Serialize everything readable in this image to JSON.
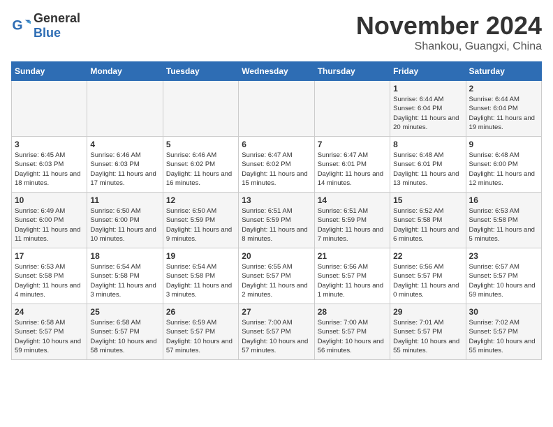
{
  "logo": {
    "text_general": "General",
    "text_blue": "Blue"
  },
  "title": {
    "month_year": "November 2024",
    "location": "Shankou, Guangxi, China"
  },
  "weekdays": [
    "Sunday",
    "Monday",
    "Tuesday",
    "Wednesday",
    "Thursday",
    "Friday",
    "Saturday"
  ],
  "weeks": [
    [
      {
        "day": "",
        "info": ""
      },
      {
        "day": "",
        "info": ""
      },
      {
        "day": "",
        "info": ""
      },
      {
        "day": "",
        "info": ""
      },
      {
        "day": "",
        "info": ""
      },
      {
        "day": "1",
        "info": "Sunrise: 6:44 AM\nSunset: 6:04 PM\nDaylight: 11 hours and 20 minutes."
      },
      {
        "day": "2",
        "info": "Sunrise: 6:44 AM\nSunset: 6:04 PM\nDaylight: 11 hours and 19 minutes."
      }
    ],
    [
      {
        "day": "3",
        "info": "Sunrise: 6:45 AM\nSunset: 6:03 PM\nDaylight: 11 hours and 18 minutes."
      },
      {
        "day": "4",
        "info": "Sunrise: 6:46 AM\nSunset: 6:03 PM\nDaylight: 11 hours and 17 minutes."
      },
      {
        "day": "5",
        "info": "Sunrise: 6:46 AM\nSunset: 6:02 PM\nDaylight: 11 hours and 16 minutes."
      },
      {
        "day": "6",
        "info": "Sunrise: 6:47 AM\nSunset: 6:02 PM\nDaylight: 11 hours and 15 minutes."
      },
      {
        "day": "7",
        "info": "Sunrise: 6:47 AM\nSunset: 6:01 PM\nDaylight: 11 hours and 14 minutes."
      },
      {
        "day": "8",
        "info": "Sunrise: 6:48 AM\nSunset: 6:01 PM\nDaylight: 11 hours and 13 minutes."
      },
      {
        "day": "9",
        "info": "Sunrise: 6:48 AM\nSunset: 6:00 PM\nDaylight: 11 hours and 12 minutes."
      }
    ],
    [
      {
        "day": "10",
        "info": "Sunrise: 6:49 AM\nSunset: 6:00 PM\nDaylight: 11 hours and 11 minutes."
      },
      {
        "day": "11",
        "info": "Sunrise: 6:50 AM\nSunset: 6:00 PM\nDaylight: 11 hours and 10 minutes."
      },
      {
        "day": "12",
        "info": "Sunrise: 6:50 AM\nSunset: 5:59 PM\nDaylight: 11 hours and 9 minutes."
      },
      {
        "day": "13",
        "info": "Sunrise: 6:51 AM\nSunset: 5:59 PM\nDaylight: 11 hours and 8 minutes."
      },
      {
        "day": "14",
        "info": "Sunrise: 6:51 AM\nSunset: 5:59 PM\nDaylight: 11 hours and 7 minutes."
      },
      {
        "day": "15",
        "info": "Sunrise: 6:52 AM\nSunset: 5:58 PM\nDaylight: 11 hours and 6 minutes."
      },
      {
        "day": "16",
        "info": "Sunrise: 6:53 AM\nSunset: 5:58 PM\nDaylight: 11 hours and 5 minutes."
      }
    ],
    [
      {
        "day": "17",
        "info": "Sunrise: 6:53 AM\nSunset: 5:58 PM\nDaylight: 11 hours and 4 minutes."
      },
      {
        "day": "18",
        "info": "Sunrise: 6:54 AM\nSunset: 5:58 PM\nDaylight: 11 hours and 3 minutes."
      },
      {
        "day": "19",
        "info": "Sunrise: 6:54 AM\nSunset: 5:58 PM\nDaylight: 11 hours and 3 minutes."
      },
      {
        "day": "20",
        "info": "Sunrise: 6:55 AM\nSunset: 5:57 PM\nDaylight: 11 hours and 2 minutes."
      },
      {
        "day": "21",
        "info": "Sunrise: 6:56 AM\nSunset: 5:57 PM\nDaylight: 11 hours and 1 minute."
      },
      {
        "day": "22",
        "info": "Sunrise: 6:56 AM\nSunset: 5:57 PM\nDaylight: 11 hours and 0 minutes."
      },
      {
        "day": "23",
        "info": "Sunrise: 6:57 AM\nSunset: 5:57 PM\nDaylight: 10 hours and 59 minutes."
      }
    ],
    [
      {
        "day": "24",
        "info": "Sunrise: 6:58 AM\nSunset: 5:57 PM\nDaylight: 10 hours and 59 minutes."
      },
      {
        "day": "25",
        "info": "Sunrise: 6:58 AM\nSunset: 5:57 PM\nDaylight: 10 hours and 58 minutes."
      },
      {
        "day": "26",
        "info": "Sunrise: 6:59 AM\nSunset: 5:57 PM\nDaylight: 10 hours and 57 minutes."
      },
      {
        "day": "27",
        "info": "Sunrise: 7:00 AM\nSunset: 5:57 PM\nDaylight: 10 hours and 57 minutes."
      },
      {
        "day": "28",
        "info": "Sunrise: 7:00 AM\nSunset: 5:57 PM\nDaylight: 10 hours and 56 minutes."
      },
      {
        "day": "29",
        "info": "Sunrise: 7:01 AM\nSunset: 5:57 PM\nDaylight: 10 hours and 55 minutes."
      },
      {
        "day": "30",
        "info": "Sunrise: 7:02 AM\nSunset: 5:57 PM\nDaylight: 10 hours and 55 minutes."
      }
    ]
  ]
}
